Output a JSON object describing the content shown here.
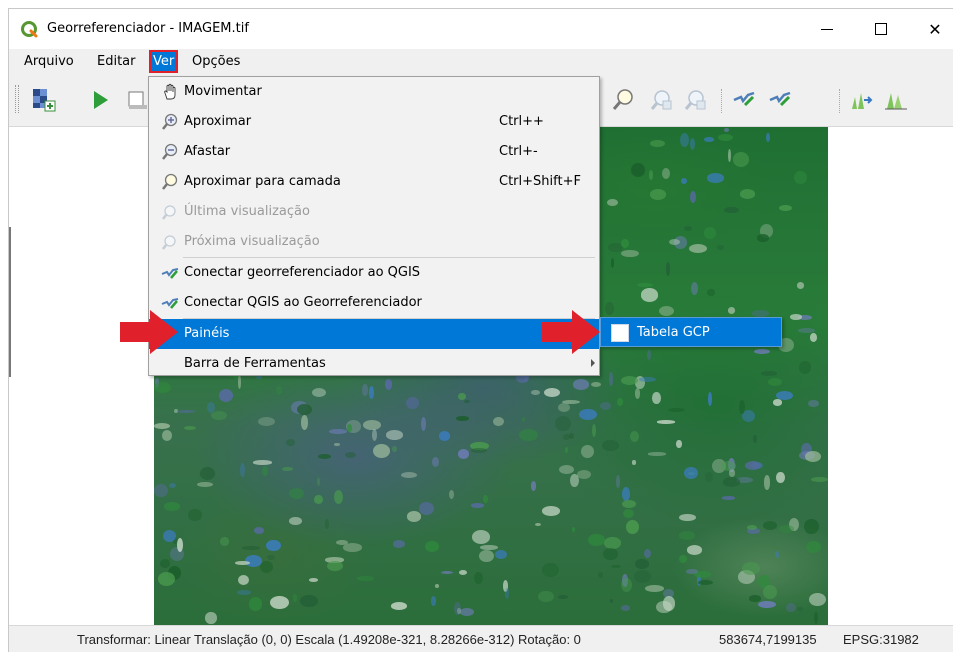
{
  "window": {
    "title": "Georreferenciador - IMAGEM.tif",
    "app_icon": "qgis-icon",
    "controls": {
      "minimize": "minimize-icon",
      "maximize": "maximize-icon",
      "close": "close-icon",
      "close_glyph": "✕"
    }
  },
  "menubar": {
    "items": [
      {
        "label": "Arquivo"
      },
      {
        "label": "Editar"
      },
      {
        "label": "Ver",
        "active": true
      },
      {
        "label": "Opções"
      }
    ]
  },
  "toolbar": {
    "icons": [
      "add-raster-icon",
      "start-georeferencing-icon",
      "generate-script-icon",
      "zoom-to-layer-icon",
      "zoom-last-icon",
      "zoom-next-icon",
      "link-georef-to-qgis-icon",
      "link-qgis-to-georef-icon",
      "full-histogram-stretch-icon",
      "local-histogram-stretch-icon"
    ]
  },
  "view_menu": {
    "items": [
      {
        "label": "Movimentar",
        "icon": "hand-pan-icon",
        "shortcut": "",
        "enabled": true
      },
      {
        "label": "Aproximar",
        "icon": "zoom-in-icon",
        "shortcut": "Ctrl++",
        "enabled": true
      },
      {
        "label": "Afastar",
        "icon": "zoom-out-icon",
        "shortcut": "Ctrl+-",
        "enabled": true
      },
      {
        "label": "Aproximar para camada",
        "icon": "zoom-to-layer-icon",
        "shortcut": "Ctrl+Shift+F",
        "enabled": true
      },
      {
        "label": "Última visualização",
        "icon": "zoom-last-icon",
        "shortcut": "",
        "enabled": false
      },
      {
        "label": "Próxima visualização",
        "icon": "zoom-next-icon",
        "shortcut": "",
        "enabled": false
      },
      {
        "label": "Conectar georreferenciador ao QGIS",
        "icon": "link-georef-to-qgis-icon",
        "shortcut": "",
        "enabled": true
      },
      {
        "label": "Conectar QGIS ao Georreferenciador",
        "icon": "link-qgis-to-georef-icon",
        "shortcut": "",
        "enabled": true
      },
      {
        "label": "Painéis",
        "icon": "",
        "shortcut": "",
        "enabled": true,
        "highlighted": true,
        "submenu": true
      },
      {
        "label": "Barra de Ferramentas",
        "icon": "",
        "shortcut": "",
        "enabled": true,
        "submenu": true
      }
    ]
  },
  "panels_submenu": {
    "items": [
      {
        "label": "Tabela GCP",
        "checked": false
      }
    ]
  },
  "statusbar": {
    "transform": "Transformar: Linear Translação (0, 0) Escala (1.49208e-321, 8.28266e-312) Rotação: 0",
    "coordinates": "583674,7199135",
    "crs": "EPSG:31982"
  },
  "colors": {
    "highlight": "#0078d7",
    "annotation_red": "#e0202a",
    "menu_bg": "#f2f2f2",
    "chrome_bg": "#f0f0f0"
  }
}
